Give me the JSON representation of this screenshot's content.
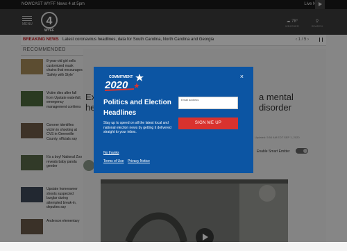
{
  "topbar": {
    "nowcast": "NOWCAST WYFF News 4 at 5pm",
    "live_now": "Live Now"
  },
  "header": {
    "menu_label": "MENU",
    "weather_temp": "78°",
    "weather_label": "WEATHER",
    "search_label": "SEARCH"
  },
  "breaking": {
    "tag": "BREAKING NEWS",
    "headline": "Latest coronavirus headlines, data for South Carolina, North Carolina and Georgia",
    "pager": "1 / 5"
  },
  "sidebar": {
    "heading": "RECOMMENDED",
    "items": [
      {
        "text": "8-year-old girl sells customized mask chains that encourages 'Safety with Style'",
        "thumb_color": "#a88d5a"
      },
      {
        "text": "Victim dies after fall from Upstate waterfall, emergency management confirms",
        "thumb_color": "#4e6b3d"
      },
      {
        "text": "Coroner identifies victim in shooting at CVS in Greenville County, officials say",
        "thumb_color": "#6f5b47"
      },
      {
        "text": "It's a boy! National Zoo reveals baby panda gender",
        "thumb_color": "#5a6b4a"
      },
      {
        "text": "Upstate homeowner shoots suspected burglar during attempted break-in, deputies say",
        "thumb_color": "#3e4a5a"
      },
      {
        "text": "Anderson elementary",
        "thumb_color": "#6b5a4a"
      }
    ]
  },
  "article": {
    "title_left": "Ex",
    "title_left2": "he",
    "title_right": "a mental",
    "title_right2": "disorder",
    "updated": "Updated: 5:54 AM EDT SEP 1, 2020",
    "toggle_label": "Enable Smart Emitter"
  },
  "modal": {
    "badge_top": "COMMITMENT",
    "badge_year": "2020",
    "heading": "Politics and Election Headlines",
    "blurb": "Stay up to speed on all the latest local and national election news by getting it delivered straight to your inbox.",
    "email_label": "Email address",
    "signup": "SIGN ME UP",
    "no_thanks": "No thanks",
    "terms": "Terms of Use",
    "privacy": "Privacy Notice",
    "close": "×",
    "colors": {
      "modal_bg": "#0c55a3",
      "signup_bg": "#d9322e",
      "breaking": "#c4161c"
    }
  }
}
